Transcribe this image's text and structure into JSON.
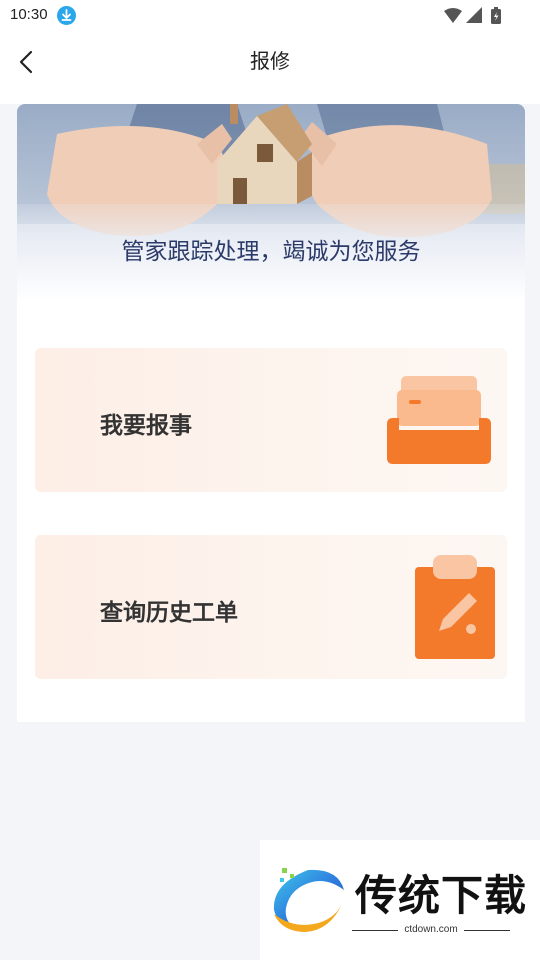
{
  "status_bar": {
    "time": "10:30",
    "icons": [
      "download-icon",
      "wifi-icon",
      "signal-icon",
      "battery-icon"
    ],
    "download_color": "#2aa6ec"
  },
  "nav": {
    "title": "报修",
    "back_icon": "chevron-left-icon"
  },
  "banner": {
    "text": "管家跟踪处理，竭诚为您服务",
    "text_color": "#2b3a69"
  },
  "menu": [
    {
      "label": "我要报事",
      "icon": "inbox-tray-icon"
    },
    {
      "label": "查询历史工单",
      "icon": "clipboard-edit-icon"
    }
  ],
  "accent_color": "#f47a2b",
  "watermark": {
    "brand": "传统下载",
    "url": "ctdown.com"
  }
}
